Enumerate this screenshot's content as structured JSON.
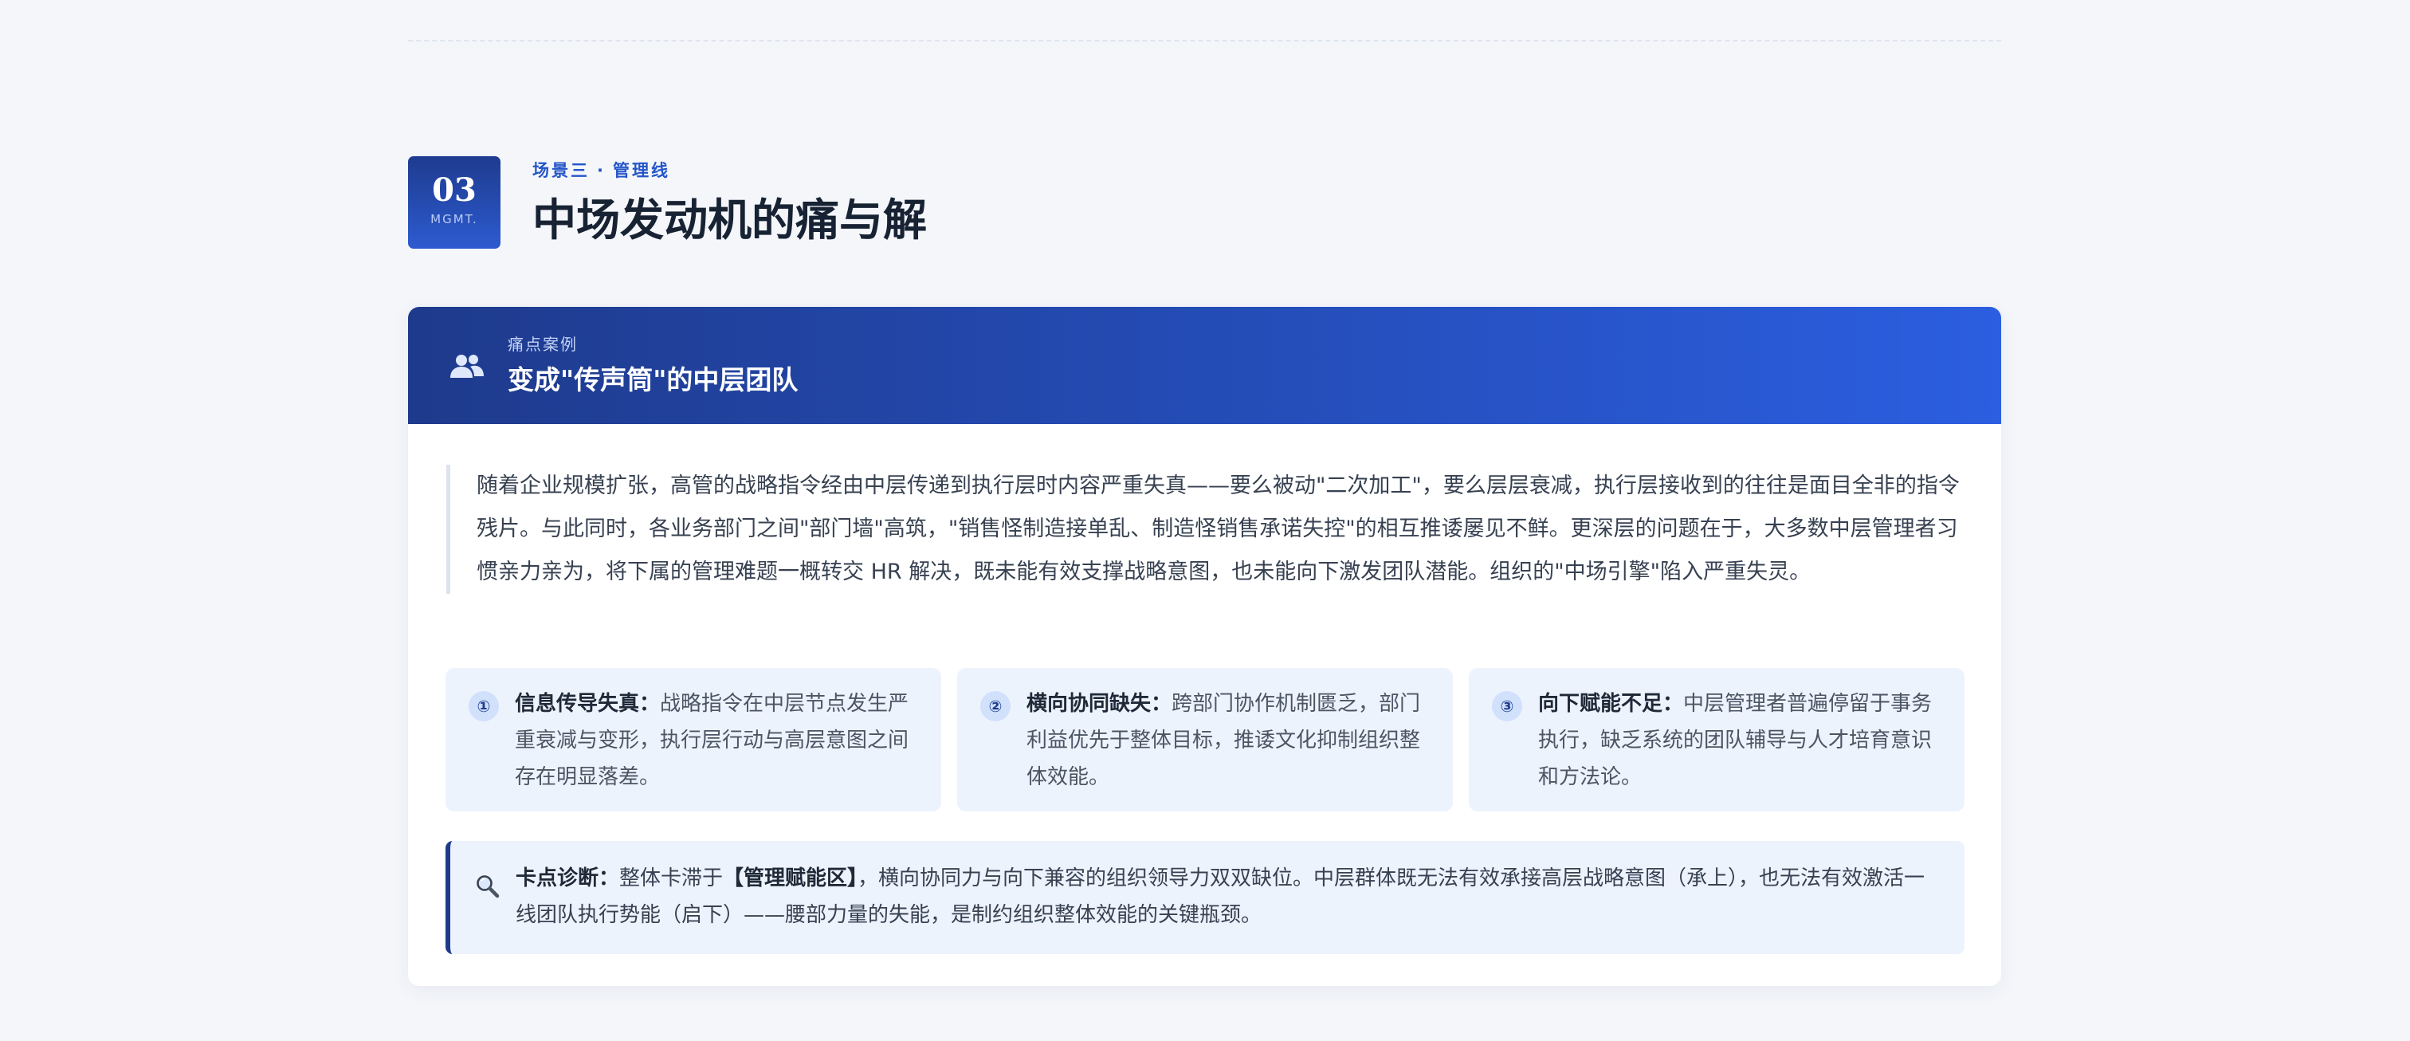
{
  "section": {
    "number": "03",
    "abbr": "MGMT.",
    "kicker_left": "场景三",
    "kicker_separator": "·",
    "kicker_right": "管理线",
    "title": "中场发动机的痛与解"
  },
  "card": {
    "icon": "users-icon",
    "kicker": "痛点案例",
    "title": "变成\"传声筒\"的中层团队",
    "intro": "随着企业规模扩张，高管的战略指令经由中层传递到执行层时内容严重失真——要么被动\"二次加工\"，要么层层衰减，执行层接收到的往往是面目全非的指令残片。与此同时，各业务部门之间\"部门墙\"高筑，\"销售怪制造接单乱、制造怪销售承诺失控\"的相互推诿屡见不鲜。更深层的问题在于，大多数中层管理者习惯亲力亲为，将下属的管理难题一概转交 HR 解决，既未能有效支撑战略意图，也未能向下激发团队潜能。组织的\"中场引擎\"陷入严重失灵。",
    "points": [
      {
        "num": "①",
        "label": "信息传导失真：",
        "text": "战略指令在中层节点发生严重衰减与变形，执行层行动与高层意图之间存在明显落差。"
      },
      {
        "num": "②",
        "label": "横向协同缺失：",
        "text": "跨部门协作机制匮乏，部门利益优先于整体目标，推诿文化抑制组织整体效能。"
      },
      {
        "num": "③",
        "label": "向下赋能不足：",
        "text": "中层管理者普遍停留于事务执行，缺乏系统的团队辅导与人才培育意识和方法论。"
      }
    ],
    "diagnosis": {
      "icon": "search-icon",
      "label": "卡点诊断：",
      "text_before": "整体卡滞于",
      "key": "【管理赋能区】",
      "text_after": "，横向协同力与向下兼容的组织领导力双双缺位。中层群体既无法有效承接高层战略意图（承上），也无法有效激活一线团队执行势能（启下）——腰部力量的失能，是制约组织整体效能的关键瓶颈。"
    }
  },
  "colors": {
    "accent": "#2355c9",
    "header_start": "#1e3a8c",
    "header_end": "#2b5ee0",
    "panel_bg": "#edf3fd",
    "page_bg": "#f4f6fa"
  }
}
